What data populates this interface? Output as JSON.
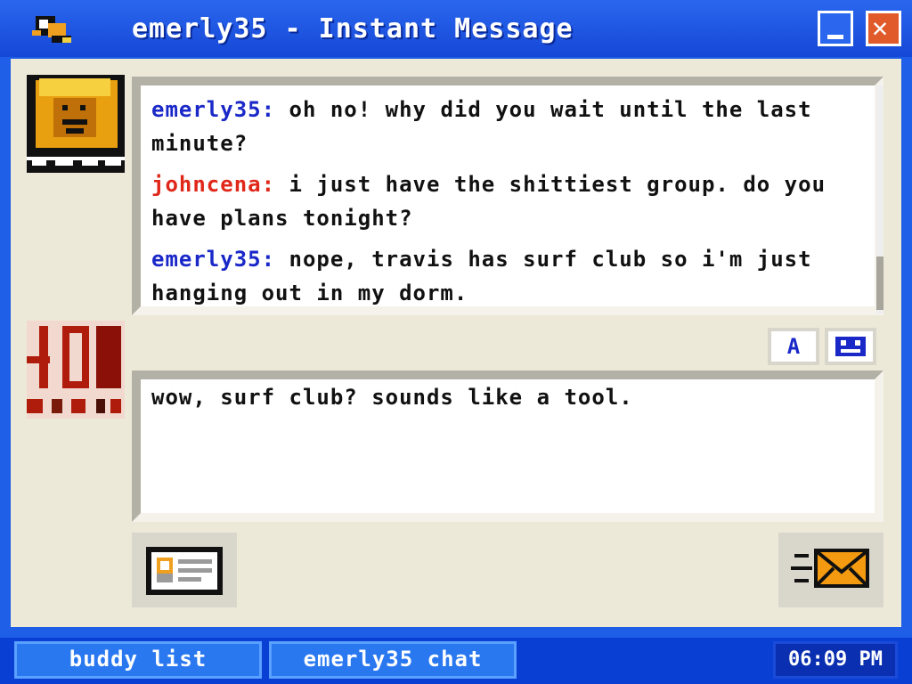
{
  "window": {
    "title": "emerly35 - Instant Message",
    "minimize_icon": "minimize-icon",
    "close_icon": "close-icon"
  },
  "chat": {
    "messages": [
      {
        "sender": "emerly35:",
        "text": " oh no! why did you wait until the last minute?",
        "sender_color": "#1a28c8"
      },
      {
        "sender": "johncena:",
        "text": " i just have the shittiest group. do you have plans tonight?",
        "sender_color": "#e0281a"
      },
      {
        "sender": "emerly35:",
        "text": " nope, travis has surf club so i'm just hanging out in my dorm.",
        "sender_color": "#1a28c8"
      }
    ]
  },
  "formatting": {
    "font_button": "A",
    "face_icon": "emoticon-icon"
  },
  "input": {
    "value": "wow, surf club? sounds like a tool."
  },
  "actions": {
    "profile_icon": "profile-card-icon",
    "send_icon": "send-mail-icon"
  },
  "taskbar": {
    "tabs": [
      {
        "label": "buddy list"
      },
      {
        "label": "emerly35 chat"
      }
    ],
    "clock": "06:09 PM"
  },
  "colors": {
    "accent": "#1f5ee6",
    "panel": "#ece9d8",
    "sender_blue": "#1a28c8",
    "sender_red": "#e0281a"
  }
}
